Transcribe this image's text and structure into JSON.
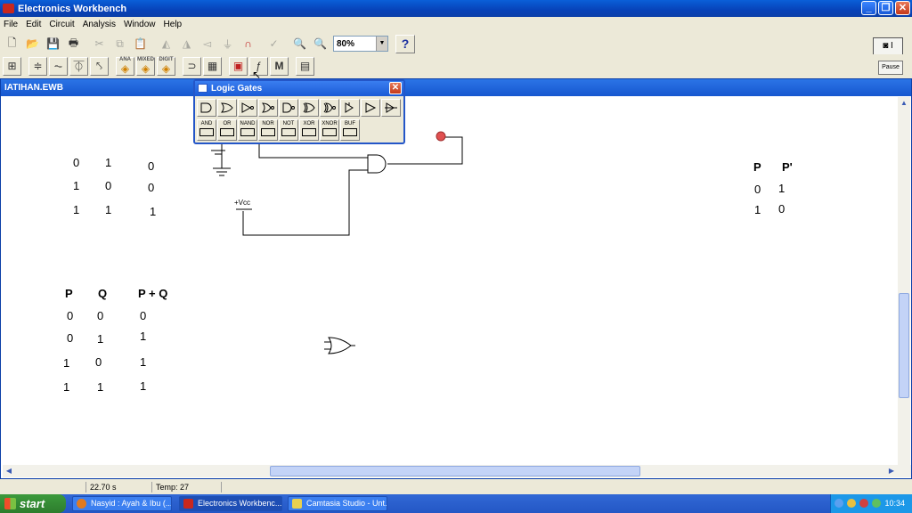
{
  "app": {
    "title": "Electronics Workbench"
  },
  "menu": [
    "File",
    "Edit",
    "Circuit",
    "Analysis",
    "Window",
    "Help"
  ],
  "toolbar": {
    "zoom_value": "80%",
    "help_label": "?",
    "pause_label": "Pause",
    "parts_bin_labels": [
      "ANA",
      "MIXED",
      "DIGIT"
    ],
    "m_label": "M"
  },
  "document": {
    "title": "IATIHAN.EWB",
    "vcc_label": "+Vcc",
    "table_and_values": [
      [
        "0",
        "1",
        "0"
      ],
      [
        "1",
        "0",
        "0"
      ],
      [
        "1",
        "1",
        "1"
      ]
    ],
    "table_not": {
      "headers": [
        "P",
        "P'"
      ],
      "rows": [
        [
          "0",
          "1"
        ],
        [
          "1",
          "0"
        ]
      ]
    },
    "table_or": {
      "headers": [
        "P",
        "Q",
        "P + Q"
      ],
      "rows": [
        [
          "0",
          "0",
          "0"
        ],
        [
          "0",
          "1",
          "1"
        ],
        [
          "1",
          "0",
          "1"
        ],
        [
          "1",
          "1",
          "1"
        ]
      ]
    }
  },
  "palette": {
    "title": "Logic Gates",
    "labels": [
      "AND",
      "OR",
      "NAND",
      "NOR",
      "NOT",
      "XOR",
      "XNOR",
      "BUF"
    ]
  },
  "statusbar": {
    "time": "22.70 s",
    "temp": "Temp:  27"
  },
  "taskbar": {
    "start_label": "start",
    "tasks": [
      "Nasyid : Ayah & Ibu (...",
      "Electronics Workbenc...",
      "Camtasia Studio - Unt..."
    ],
    "clock": "10:34"
  },
  "colors": {
    "title_blue": "#0742b8",
    "probe_red": "#e05050",
    "taskbar_blue": "#2457c5",
    "start_green": "#2d7d2d"
  }
}
